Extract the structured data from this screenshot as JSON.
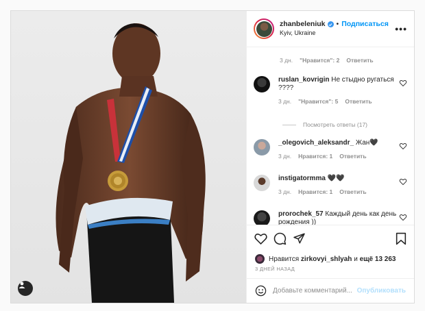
{
  "header": {
    "username": "zhanbeleniuk",
    "follow_label": "Подписаться",
    "separator": "•",
    "location": "Kyiv, Ukraine",
    "more_label": "•••"
  },
  "comments": [
    {
      "meta": {
        "time": "3 дн.",
        "likes": "\"Нравится\": 2",
        "reply": "Ответить"
      }
    },
    {
      "username": "ruslan_kovrigin",
      "text": "Не стыдно ругаться ????",
      "meta": {
        "time": "3 дн.",
        "likes": "\"Нравится\": 5",
        "reply": "Ответить"
      }
    },
    {
      "replies_label": "Посмотреть ответы (17)"
    },
    {
      "username": "_olegovich_aleksandr_",
      "text": "Жан🖤",
      "meta": {
        "time": "3 дн.",
        "likes": "Нравится: 1",
        "reply": "Ответить"
      }
    },
    {
      "username": "instigatormma",
      "text": "🖤🖤",
      "meta": {
        "time": "3 дн.",
        "likes": "Нравится: 1",
        "reply": "Ответить"
      }
    },
    {
      "username": "prorochek_57",
      "text": "Каждый день как день рождения ))"
    }
  ],
  "likes": {
    "prefix": "Нравится",
    "user": "zirkovyi_shlyah",
    "suffix": "и",
    "others": "ещё 13 263"
  },
  "date": "3 ДНЕЙ НАЗАД",
  "add_comment": {
    "placeholder": "Добавьте комментарий...",
    "post_label": "Опубликовать"
  },
  "colors": {
    "link_blue": "#0095f6",
    "muted": "#8e8e8e",
    "medal_ribbon": "#1e4fa8",
    "skin": "#6b3f2a"
  }
}
